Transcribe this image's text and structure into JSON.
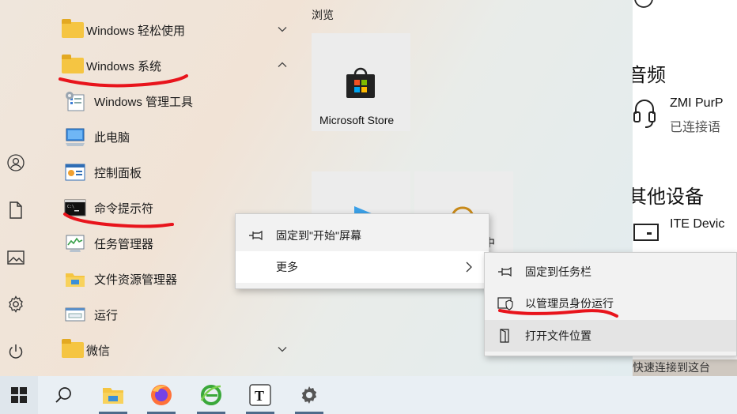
{
  "start_menu": {
    "apps": [
      {
        "label": "Windows 轻松使用",
        "type": "folder",
        "expanded": false
      },
      {
        "label": "Windows 系统",
        "type": "folder",
        "expanded": true
      },
      {
        "label": "Windows 管理工具",
        "type": "app"
      },
      {
        "label": "此电脑",
        "type": "app"
      },
      {
        "label": "控制面板",
        "type": "app"
      },
      {
        "label": "命令提示符",
        "type": "app"
      },
      {
        "label": "任务管理器",
        "type": "app"
      },
      {
        "label": "文件资源管理器",
        "type": "app"
      },
      {
        "label": "运行",
        "type": "app"
      },
      {
        "label": "微信",
        "type": "folder",
        "expanded": false
      }
    ],
    "tiles_section_label": "浏览",
    "tiles": [
      {
        "label": "Microsoft Store",
        "icon": "store-bag-icon"
      },
      {
        "label": "",
        "icon": "partial-blue-icon"
      },
      {
        "label": "中",
        "icon": "partial-app-icon"
      }
    ]
  },
  "context_menu": {
    "items": [
      {
        "label": "固定到\"开始\"屏幕",
        "icon": "pin-icon"
      },
      {
        "label": "更多",
        "icon": "",
        "has_submenu": true
      }
    ]
  },
  "submenu": {
    "items": [
      {
        "label": "固定到任务栏",
        "icon": "pin-icon"
      },
      {
        "label": "以管理员身份运行",
        "icon": "admin-shield-icon"
      },
      {
        "label": "打开文件位置",
        "icon": "file-location-icon"
      }
    ]
  },
  "settings_panel": {
    "audio_heading": "音频",
    "device_name": "ZMI PurP",
    "device_status": "已连接语",
    "other_heading": "其他设备",
    "other_device": "ITE Devic",
    "bottom_text": "快速连接到这台"
  },
  "taskbar": {
    "icons": [
      "windows-start-icon",
      "search-icon",
      "file-explorer-icon",
      "firefox-icon",
      "ie-icon",
      "typora-icon",
      "settings-gear-icon"
    ]
  },
  "colors": {
    "folder": "#f5c542",
    "marker_red": "#e8141c",
    "menu_bg": "#f2f2f2",
    "taskbar_bg": "#e9eff4"
  }
}
